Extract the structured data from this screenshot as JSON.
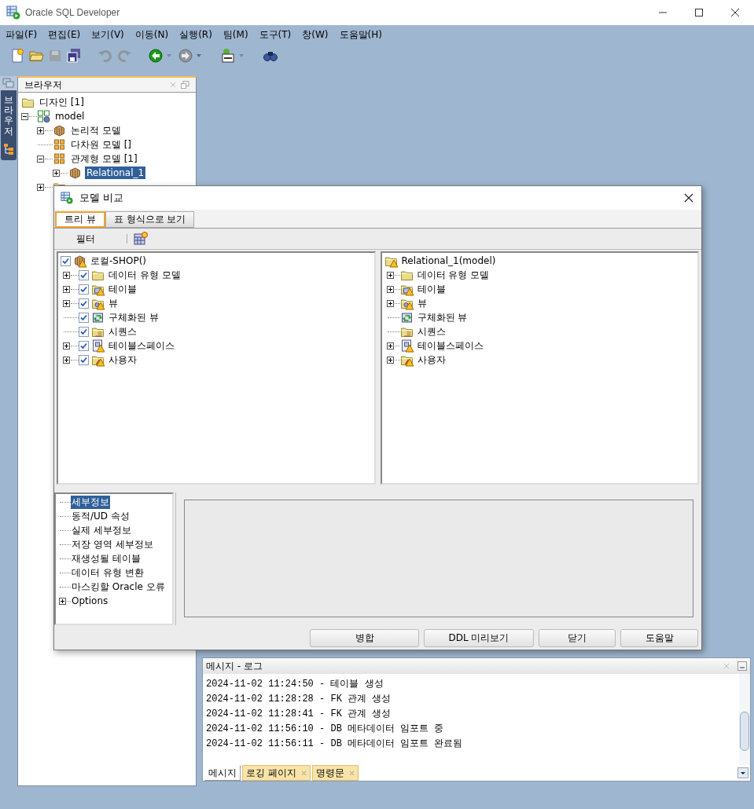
{
  "window": {
    "title": "Oracle SQL Developer"
  },
  "menu": [
    "파일(F)",
    "편집(E)",
    "보기(V)",
    "이동(N)",
    "실행(R)",
    "팀(M)",
    "도구(T)",
    "창(W)",
    "도움말(H)"
  ],
  "toolbar": [
    {
      "kind": "new",
      "disabled": false
    },
    {
      "kind": "open",
      "disabled": false
    },
    {
      "kind": "save",
      "disabled": true
    },
    {
      "kind": "save-all",
      "disabled": false
    },
    {
      "kind": "undo",
      "disabled": true
    },
    {
      "kind": "redo",
      "disabled": true
    },
    {
      "kind": "back",
      "disabled": false
    },
    {
      "kind": "forward",
      "disabled": true
    },
    {
      "kind": "sql",
      "disabled": false
    },
    {
      "kind": "find",
      "disabled": false
    }
  ],
  "side_tab": {
    "label": "브라우저"
  },
  "browser": {
    "title": "브라우저",
    "tree": [
      {
        "label": "디자인 [1]",
        "kind": "folder",
        "selected": false,
        "children": [
          {
            "label": "model",
            "kind": "model",
            "expanded": true,
            "selected": false,
            "children": [
              {
                "label": "논리적 모델",
                "kind": "cube",
                "expanded": false,
                "selected": false
              },
              {
                "label": "다차원 모델 []",
                "kind": "grid",
                "selected": false
              },
              {
                "label": "관계형 모델 [1]",
                "kind": "grid",
                "expanded": true,
                "selected": false,
                "children": [
                  {
                    "label": "Relational_1",
                    "kind": "cube",
                    "expanded": false,
                    "selected": true
                  }
                ]
              },
              {
                "kind": "table",
                "expanded": false
              }
            ]
          }
        ]
      }
    ]
  },
  "dialog": {
    "title": "모델 비교",
    "tabs": [
      {
        "label": "트리 뷰",
        "selected": true
      },
      {
        "label": "표 형식으로 보기",
        "selected": false
      }
    ],
    "filter_button": "필터",
    "left_tree": {
      "label": "로컬-SHOP()",
      "kind": "cube",
      "warning": true,
      "checked": true,
      "children": [
        {
          "label": "데이터 유형 모델",
          "kind": "folder",
          "warning": false,
          "checked": true,
          "expandable": true
        },
        {
          "label": "테이블",
          "kind": "table",
          "warning": true,
          "checked": true,
          "expandable": true
        },
        {
          "label": "뷰",
          "kind": "view",
          "warning": true,
          "checked": true,
          "expandable": true
        },
        {
          "label": "구체화된 뷰",
          "kind": "mview",
          "warning": false,
          "checked": true,
          "expandable": false
        },
        {
          "label": "시퀀스",
          "kind": "sequence",
          "warning": false,
          "checked": true,
          "expandable": false
        },
        {
          "label": "테이블스페이스",
          "kind": "tablespace",
          "warning": true,
          "checked": true,
          "expandable": true
        },
        {
          "label": "사용자",
          "kind": "user",
          "warning": true,
          "checked": true,
          "expandable": true
        }
      ]
    },
    "right_tree": {
      "label": "Relational_1(model)",
      "kind": "folder",
      "warning": true,
      "children": [
        {
          "label": "데이터 유형 모델",
          "kind": "folder",
          "warning": false,
          "expandable": true
        },
        {
          "label": "테이블",
          "kind": "table",
          "warning": true,
          "expandable": true
        },
        {
          "label": "뷰",
          "kind": "view",
          "warning": true,
          "expandable": true
        },
        {
          "label": "구체화된 뷰",
          "kind": "mview",
          "warning": false,
          "expandable": false
        },
        {
          "label": "시퀀스",
          "kind": "sequence",
          "warning": false,
          "expandable": false
        },
        {
          "label": "테이블스페이스",
          "kind": "tablespace",
          "warning": true,
          "expandable": true
        },
        {
          "label": "사용자",
          "kind": "user",
          "warning": true,
          "expandable": true
        }
      ]
    },
    "nav": [
      {
        "label": "세부정보",
        "selected": true,
        "expandable": false
      },
      {
        "label": "동적/UD 속성",
        "selected": false,
        "expandable": false
      },
      {
        "label": "실제 세부정보",
        "selected": false,
        "expandable": false
      },
      {
        "label": "저장 영역 세부정보",
        "selected": false,
        "expandable": false
      },
      {
        "label": "재생성될 테이블",
        "selected": false,
        "expandable": false
      },
      {
        "label": "데이터 유형 변환",
        "selected": false,
        "expandable": false
      },
      {
        "label": "마스킹할 Oracle 오류",
        "selected": false,
        "expandable": false
      },
      {
        "label": "Options",
        "selected": false,
        "expandable": true
      }
    ],
    "buttons": [
      "병합",
      "DDL 미리보기",
      "닫기",
      "도움말"
    ]
  },
  "messages": {
    "title": "메시지 - 로그",
    "lines": [
      "2024-11-02 11:24:50 - 테이블 생성",
      "2024-11-02 11:28:28 - FK 관계 생성",
      "2024-11-02 11:28:41 - FK 관계 생성",
      "2024-11-02 11:56:10 - DB 메타데이터 임포트 중",
      "2024-11-02 11:56:11 - DB 메타데이터 임포트 완료됨"
    ],
    "tabs": [
      {
        "label": "메시지",
        "selected": true,
        "closable": false
      },
      {
        "label": "로깅 페이지",
        "selected": false,
        "closable": true
      },
      {
        "label": "명령문",
        "selected": false,
        "closable": true
      }
    ]
  }
}
